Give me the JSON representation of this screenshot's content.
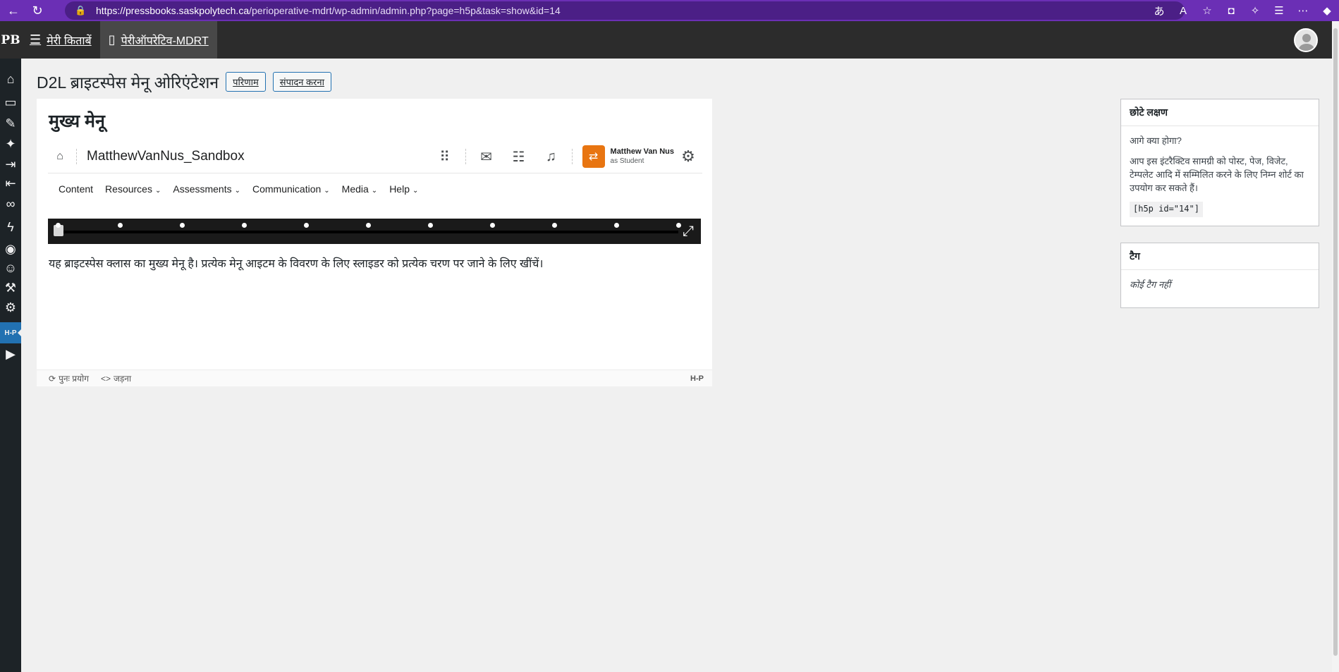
{
  "browser": {
    "url_host": "https://pressbooks.saskpolytech.ca",
    "url_path": "/perioperative-mdrt/wp-admin/admin.php?page=h5p&task=show&id=14"
  },
  "admin_bar": {
    "logo": "PB",
    "my_books": "मेरी किताबें",
    "current_book": "पेरीऑपरेटिव-MDRT"
  },
  "page": {
    "title": "D2L ब्राइटस्पेस मेनू ओरिएंटेशन",
    "results_btn": "परिणाम",
    "edit_btn": "संपादन करना"
  },
  "content": {
    "heading": "मुख्य मेनू",
    "course_name": "MatthewVanNus_Sandbox",
    "user_name": "Matthew Van Nus",
    "user_role": "as Student",
    "menu": [
      {
        "label": "Content",
        "dropdown": false
      },
      {
        "label": "Resources",
        "dropdown": true
      },
      {
        "label": "Assessments",
        "dropdown": true
      },
      {
        "label": "Communication",
        "dropdown": true
      },
      {
        "label": "Media",
        "dropdown": true
      },
      {
        "label": "Help",
        "dropdown": true
      }
    ],
    "slider_steps": 11,
    "slider_position": 0,
    "description": "यह ब्राइटस्पेस क्लास का मुख्य मेनू है। प्रत्येक मेनू आइटम के विवरण के लिए स्लाइडर को प्रत्येक चरण पर जाने के लिए खींचें।",
    "footer": {
      "reuse": "पुनः प्रयोग",
      "embed": "जड़ना",
      "h5p": "H-P"
    }
  },
  "widgets": {
    "shortcode": {
      "title": "छोटे लक्षण",
      "question": "आगे क्या होगा?",
      "text": "आप इस इंटरैक्टिव सामग्री को पोस्ट, पेज, विजेट, टेम्पलेट आदि में सम्मिलित करने के लिए निम्न शोर्ट का उपयोग कर सकते हैं।",
      "code": "[h5p id=\"14\"]"
    },
    "tags": {
      "title": "टैग",
      "empty": "कोई टैग नहीं"
    }
  },
  "colors": {
    "browser_accent": "#6b2fb5",
    "admin_bar": "#2c2c2c",
    "sidebar": "#1d2327",
    "link_blue": "#2271b1",
    "d2l_orange": "#e87511"
  }
}
